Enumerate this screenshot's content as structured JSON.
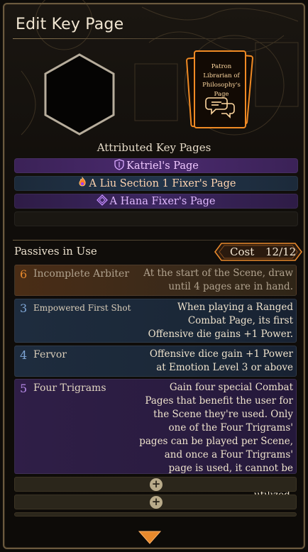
{
  "window": {
    "title": "Edit Key Page"
  },
  "key_page": {
    "card_text": "Patron Librarian of Philosophy's Page",
    "equipped_slot_icon": "empty-hexagon-icon"
  },
  "attributed": {
    "title": "Attributed Key Pages",
    "items": [
      {
        "label": "Katriel's Page",
        "icon": "shield-icon",
        "color": "#c98cff"
      },
      {
        "label": "A Liu Section 1 Fixer's Page",
        "icon": "flame-icon",
        "color": "#ffb07a"
      },
      {
        "label": "A Hana Fixer's Page",
        "icon": "diamond-icon",
        "color": "#c58cff"
      },
      {
        "label": "",
        "icon": "",
        "color": ""
      }
    ]
  },
  "passives": {
    "title": "Passives in Use",
    "cost_label": "Cost",
    "cost_value": "12/12",
    "items": [
      {
        "cost": "6",
        "name": "Incomplete Arbiter",
        "desc": "At the start of the Scene, draw until 4 pages are in hand.",
        "rarity": "orange"
      },
      {
        "cost": "3",
        "name": "Empowered First Shot",
        "desc": "When playing a Ranged Combat Page, its first Offensive die gains +1 Power.",
        "rarity": "blue"
      },
      {
        "cost": "4",
        "name": "Fervor",
        "desc": "Offensive dice gain +1 Power at Emotion Level 3 or above",
        "rarity": "blue"
      },
      {
        "cost": "5",
        "name": "Four Trigrams",
        "desc": "Gain four special Combat Pages that benefit the user for the Scene they're used. Only one of the Four Trigrams' pages can be played per Scene, and once a Four Trigrams' page is used, it cannot be reused until all four have been utilized.",
        "rarity": "purple"
      }
    ],
    "add_slot_icon": "plus-circle-icon"
  },
  "colors": {
    "accent_orange": "#e8892c",
    "gold_border": "#6b5a3e",
    "rarity_orange": "#e8892c",
    "rarity_blue": "#7fa6d6",
    "rarity_purple": "#b58ae6"
  }
}
